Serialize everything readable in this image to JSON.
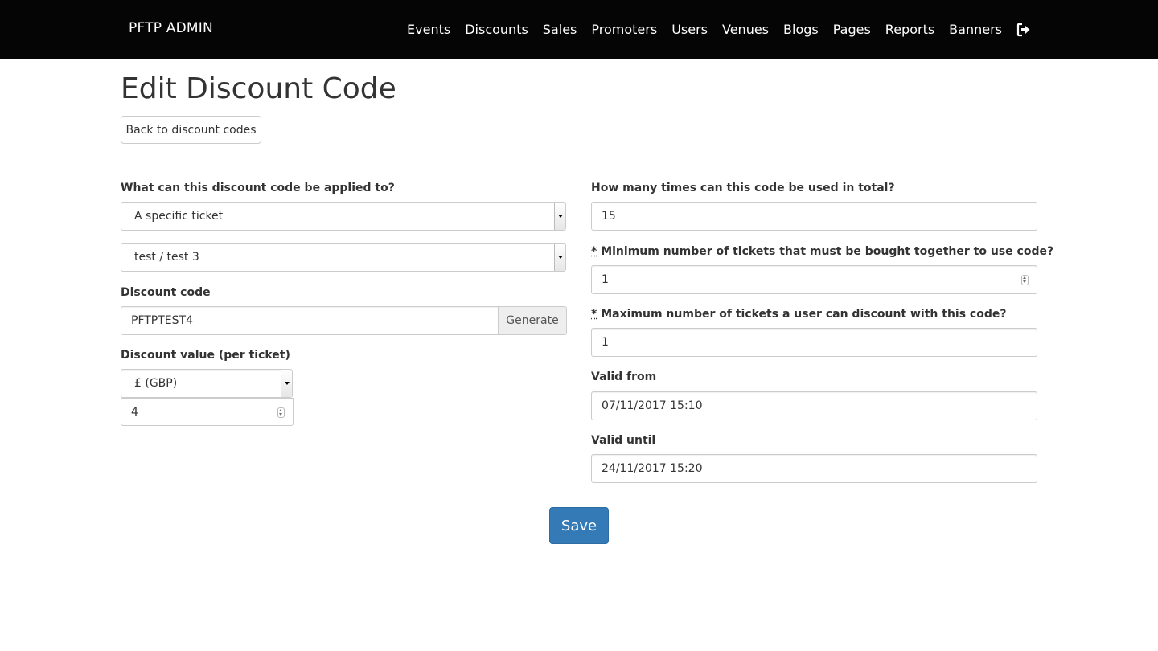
{
  "navbar": {
    "brand": "PFTP ADMIN",
    "items": [
      "Events",
      "Discounts",
      "Sales",
      "Promoters",
      "Users",
      "Venues",
      "Blogs",
      "Pages",
      "Reports",
      "Banners"
    ],
    "logout_icon": "sign-out-icon"
  },
  "page": {
    "title": "Edit Discount Code",
    "back_label": "Back to discount codes"
  },
  "left": {
    "applies_label": "What can this discount code be applied to?",
    "applies_value": "A specific ticket",
    "ticket_value": "test / test 3",
    "code_label": "Discount code",
    "code_value": "PFTPTEST4",
    "generate_label": "Generate",
    "value_label": "Discount value (per ticket)",
    "currency_value": "£ (GBP)",
    "amount_value": "4"
  },
  "right": {
    "total_uses_label": "How many times can this code be used in total?",
    "total_uses_value": "15",
    "req_mark": "*",
    "min_tickets_label": " Minimum number of tickets that must be bought together to use code?",
    "min_tickets_value": "1",
    "max_tickets_label": " Maximum number of tickets a user can discount with this code?",
    "max_tickets_value": "1",
    "valid_from_label": "Valid from",
    "valid_from_value": "07/11/2017 15:10",
    "valid_until_label": "Valid until",
    "valid_until_value": "24/11/2017 15:20"
  },
  "form": {
    "save_label": "Save"
  },
  "colors": {
    "navbar_bg": "#050505",
    "primary": "#337ab7",
    "addon_bg": "#eeeeee"
  }
}
